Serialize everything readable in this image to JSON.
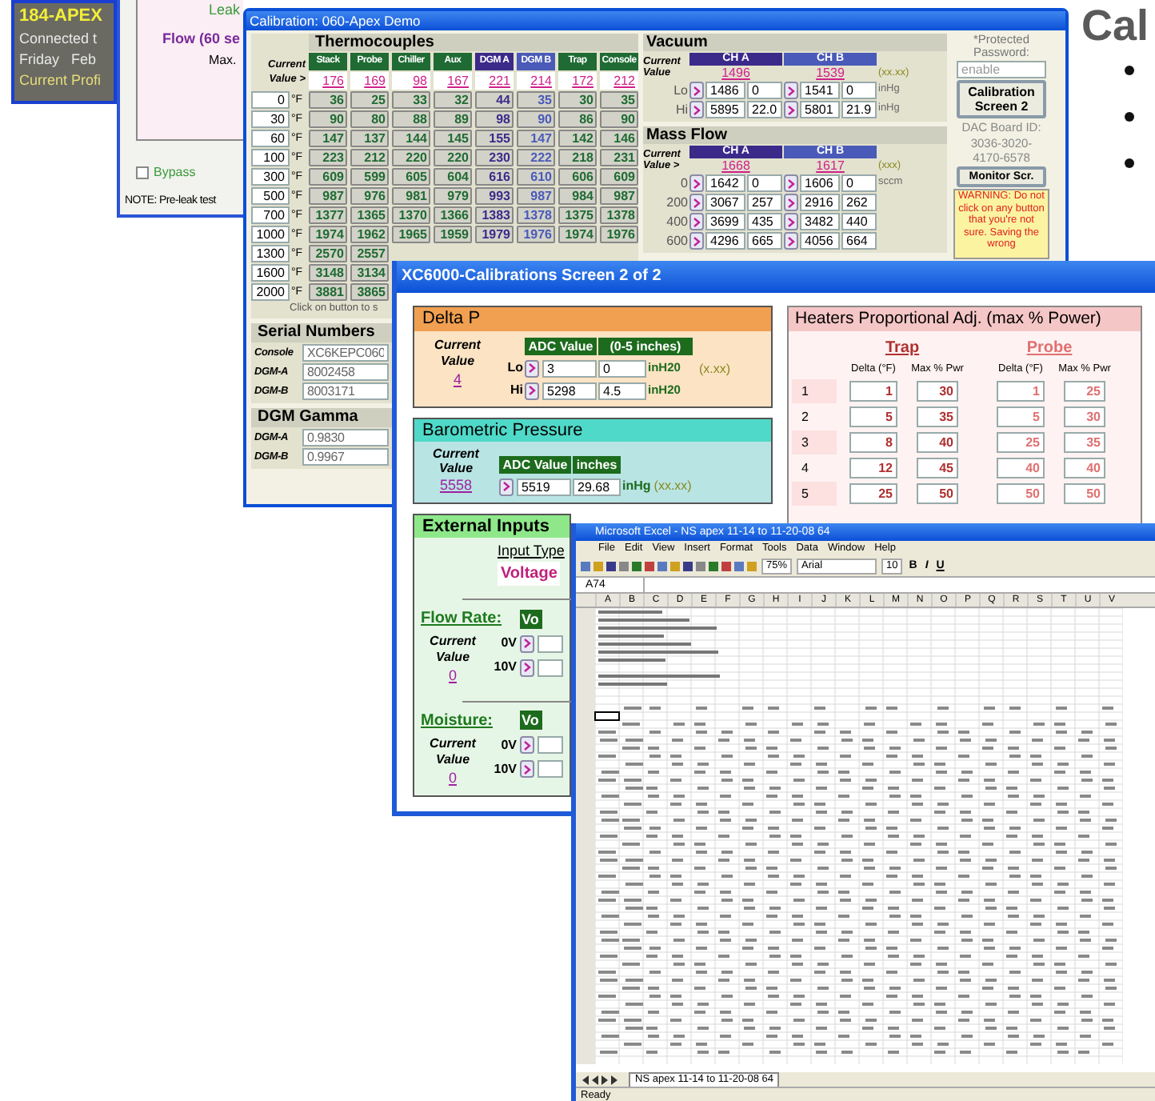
{
  "status_window": {
    "title": "184-APEX",
    "lines": [
      "Connected t",
      "Friday   Feb"
    ],
    "profile": "Current Profi"
  },
  "leak_window": {
    "leak": "Leak",
    "flow": "Flow (60 se",
    "max": "Max. ",
    "bypass": {
      "label": "Bypass",
      "checked": false
    },
    "note": "NOTE: Pre-leak test"
  },
  "calibration_window": {
    "title": "Calibration: 060-Apex Demo",
    "thermocouples": {
      "title": "Thermocouples",
      "current_label": "Current Value >",
      "columns": [
        {
          "label": "Stack",
          "color": "#1f6b33",
          "current": "176"
        },
        {
          "label": "Probe",
          "color": "#1f6b33",
          "current": "169"
        },
        {
          "label": "Chiller",
          "color": "#1f6b33",
          "current": "98"
        },
        {
          "label": "Aux",
          "color": "#1f6b33",
          "current": "167"
        },
        {
          "label": "DGM A",
          "color": "#3b2a8a",
          "current": "221"
        },
        {
          "label": "DGM B",
          "color": "#4a5ab8",
          "current": "214"
        },
        {
          "label": "Trap",
          "color": "#1f6b33",
          "current": "172"
        },
        {
          "label": "Console",
          "color": "#1f6b33",
          "current": "212"
        }
      ],
      "rows": [
        {
          "temp": "0",
          "unit": "°F",
          "values": [
            "36",
            "25",
            "33",
            "32",
            "44",
            "35",
            "30",
            "35"
          ]
        },
        {
          "temp": "30",
          "unit": "°F",
          "values": [
            "90",
            "80",
            "88",
            "89",
            "98",
            "90",
            "86",
            "90"
          ]
        },
        {
          "temp": "60",
          "unit": "°F",
          "values": [
            "147",
            "137",
            "144",
            "145",
            "155",
            "147",
            "142",
            "146"
          ]
        },
        {
          "temp": "100",
          "unit": "°F",
          "values": [
            "223",
            "212",
            "220",
            "220",
            "230",
            "222",
            "218",
            "231"
          ]
        },
        {
          "temp": "300",
          "unit": "°F",
          "values": [
            "609",
            "599",
            "605",
            "604",
            "616",
            "610",
            "606",
            "609"
          ]
        },
        {
          "temp": "500",
          "unit": "°F",
          "values": [
            "987",
            "976",
            "981",
            "979",
            "993",
            "987",
            "984",
            "987"
          ]
        },
        {
          "temp": "700",
          "unit": "°F",
          "values": [
            "1377",
            "1365",
            "1370",
            "1366",
            "1383",
            "1378",
            "1375",
            "1378"
          ]
        },
        {
          "temp": "1000",
          "unit": "°F",
          "values": [
            "1974",
            "1962",
            "1965",
            "1959",
            "1979",
            "1976",
            "1974",
            "1976"
          ]
        },
        {
          "temp": "1300",
          "unit": "°F",
          "values": [
            "2570",
            "2557"
          ]
        },
        {
          "temp": "1600",
          "unit": "°F",
          "values": [
            "3148",
            "3134"
          ]
        },
        {
          "temp": "2000",
          "unit": "°F",
          "values": [
            "3881",
            "3865"
          ]
        }
      ],
      "hint": "Click on button to s"
    },
    "serial_numbers": {
      "title": "Serial Numbers",
      "items": [
        {
          "label": "Console",
          "value": "XC6KEPC060"
        },
        {
          "label": "DGM-A",
          "value": "8002458"
        },
        {
          "label": "DGM-B",
          "value": "8003171"
        }
      ]
    },
    "dgm_gamma": {
      "title": "DGM Gamma",
      "items": [
        {
          "label": "DGM-A",
          "value": "0.9830"
        },
        {
          "label": "DGM-B",
          "value": "0.9967"
        }
      ]
    },
    "vacuum": {
      "title": "Vacuum",
      "current_label": "Current Value",
      "channels": [
        {
          "label": "CH A",
          "color": "#3b2a8a",
          "current": "1496"
        },
        {
          "label": "CH B",
          "color": "#4a5ab8",
          "current": "1539"
        }
      ],
      "format": "(xx.xx)",
      "rows": [
        {
          "label": "Lo",
          "cells": [
            [
              "1486",
              "0"
            ],
            [
              "1541",
              "0"
            ]
          ],
          "unit": "inHg"
        },
        {
          "label": "Hi",
          "cells": [
            [
              "5895",
              "22.0"
            ],
            [
              "5801",
              "21.9"
            ]
          ],
          "unit": "inHg"
        }
      ]
    },
    "mass_flow": {
      "title": "Mass Flow",
      "current_label": "Current Value >",
      "channels": [
        {
          "label": "CH A",
          "color": "#3b2a8a",
          "current": "1668"
        },
        {
          "label": "CH B",
          "color": "#4a5ab8",
          "current": "1617"
        }
      ],
      "format": "(xxx)",
      "rows": [
        {
          "label": "0",
          "cells": [
            [
              "1642",
              "0"
            ],
            [
              "1606",
              "0"
            ]
          ],
          "unit": "sccm"
        },
        {
          "label": "200",
          "cells": [
            [
              "3067",
              "257"
            ],
            [
              "2916",
              "262"
            ]
          ]
        },
        {
          "label": "400",
          "cells": [
            [
              "3699",
              "435"
            ],
            [
              "3482",
              "440"
            ]
          ]
        },
        {
          "label": "600",
          "cells": [
            [
              "4296",
              "665"
            ],
            [
              "4056",
              "664"
            ]
          ]
        }
      ]
    },
    "password": {
      "label": "*Protected Password:",
      "value": "enable"
    },
    "screen2_button": "Calibration Screen 2",
    "dac_label": "DAC Board ID:",
    "dac_id": "3036-3020-4170-6578",
    "monitor_button": "Monitor Scr.",
    "warning": "WARNING: Do not click on any button that you're not sure. Saving the wrong"
  },
  "screen2_window": {
    "title": "XC6000-Calibrations Screen 2 of 2",
    "delta_p": {
      "title": "Delta P",
      "current_label": "Current Value",
      "current": "4",
      "headers": [
        "ADC Value",
        "(0-5 inches)"
      ],
      "rows": [
        {
          "label": "Lo",
          "adc": "3",
          "value": "0",
          "unit": "inH20"
        },
        {
          "label": "Hi",
          "adc": "5298",
          "value": "4.5",
          "unit": "inH20"
        }
      ],
      "format": "(x.xx)"
    },
    "barometric": {
      "title": "Barometric Pressure",
      "current_label": "Current Value",
      "current": "5558",
      "headers": [
        "ADC Value",
        "inches"
      ],
      "adc": "5519",
      "value": "29.68",
      "unit": "inHg",
      "format": "(xx.xx)"
    },
    "external_inputs": {
      "title": "External Inputs",
      "input_type_label": "Input Type",
      "input_type": "Voltage",
      "groups": [
        {
          "label": "Flow Rate:",
          "header": "Vo",
          "current_label": "Current Value",
          "current": "0",
          "rows": [
            "0V",
            "10V"
          ]
        },
        {
          "label": "Moisture:",
          "header": "Vo",
          "current_label": "Current Value",
          "current": "0",
          "rows": [
            "0V",
            "10V"
          ]
        }
      ]
    },
    "heaters": {
      "title": "Heaters Proportional Adj. (max % Power)",
      "groups": [
        "Trap",
        "Probe"
      ],
      "subheaders": [
        "Delta (°F)",
        "Max % Pwr",
        "Delta (°F)",
        "Max % Pwr"
      ],
      "rows": [
        {
          "index": "1",
          "trap": [
            "1",
            "30"
          ],
          "probe": [
            "1",
            "25"
          ]
        },
        {
          "index": "2",
          "trap": [
            "5",
            "35"
          ],
          "probe": [
            "5",
            "30"
          ]
        },
        {
          "index": "3",
          "trap": [
            "8",
            "40"
          ],
          "probe": [
            "25",
            "35"
          ]
        },
        {
          "index": "4",
          "trap": [
            "12",
            "45"
          ],
          "probe": [
            "40",
            "40"
          ]
        },
        {
          "index": "5",
          "trap": [
            "25",
            "50"
          ],
          "probe": [
            "50",
            "50"
          ]
        }
      ]
    }
  },
  "excel_window": {
    "title": "Microsoft Excel - NS apex 11-14 to 11-20-08 64",
    "menu": [
      "File",
      "Edit",
      "View",
      "Insert",
      "Format",
      "Tools",
      "Data",
      "Window",
      "Help"
    ],
    "zoom": "75%",
    "font": "Arial",
    "font_size": "10",
    "format_buttons": [
      "B",
      "I",
      "U"
    ],
    "name_box": "A74",
    "columns": [
      "A",
      "B",
      "C",
      "D",
      "E",
      "F",
      "G",
      "H",
      "I",
      "J",
      "K",
      "L",
      "M",
      "N",
      "O",
      "P",
      "Q",
      "R",
      "S",
      "T",
      "U",
      "V"
    ],
    "sheet_tab": "NS apex 11-14 to 11-20-08 64",
    "status": "Ready"
  },
  "slide": {
    "heading": "Cal"
  }
}
